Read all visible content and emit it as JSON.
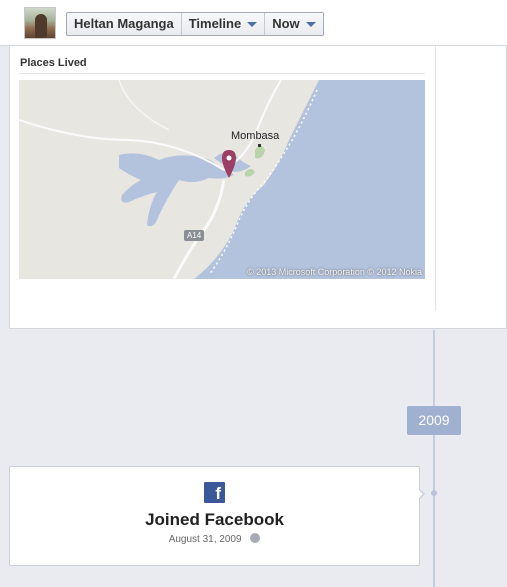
{
  "header": {
    "name_label": "Heltan Maganga",
    "timeline_label": "Timeline",
    "now_label": "Now"
  },
  "places": {
    "title": "Places Lived",
    "map": {
      "city_label": "Mombasa",
      "road_label": "A14",
      "copyright": "© 2013 Microsoft Corporation © 2012 Nokia",
      "land_color": "#e8e6e1",
      "water_color": "#b3c2dd"
    }
  },
  "timeline": {
    "year_label": "2009"
  },
  "event": {
    "icon": "facebook-icon",
    "title": "Joined Facebook",
    "date": "August 31, 2009",
    "privacy_icon": "globe-icon"
  }
}
